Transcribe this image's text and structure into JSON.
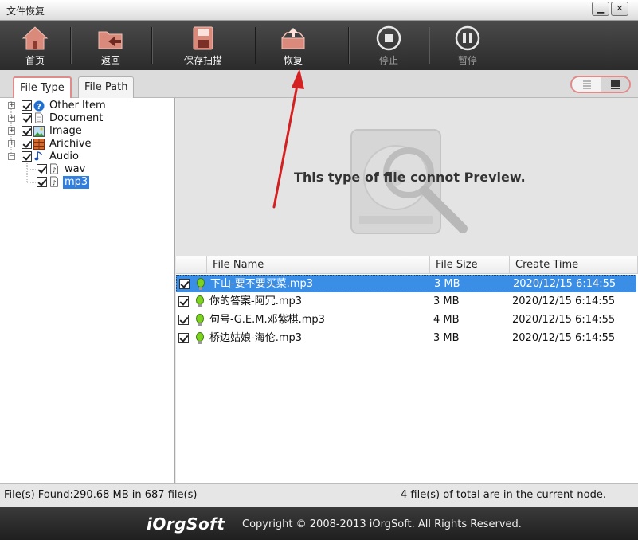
{
  "window": {
    "title": "文件恢复",
    "minimize": "▁",
    "close": "✕"
  },
  "toolbar": {
    "home": "首页",
    "back": "返回",
    "save_scan": "保存扫描",
    "recover": "恢复",
    "stop": "停止",
    "pause": "暂停"
  },
  "tabs": [
    {
      "label": "File Type",
      "active": true
    },
    {
      "label": "File Path",
      "active": false
    }
  ],
  "tree": {
    "items": [
      {
        "label": "Other Item",
        "icon": "help-icon"
      },
      {
        "label": "Document",
        "icon": "document-icon"
      },
      {
        "label": "Image",
        "icon": "image-icon"
      },
      {
        "label": "Arichive",
        "icon": "archive-icon"
      },
      {
        "label": "Audio",
        "icon": "music-note-icon",
        "children": [
          {
            "label": "wav"
          },
          {
            "label": "mp3",
            "selected": true
          }
        ]
      }
    ]
  },
  "preview": {
    "message": "This type of file connot Preview."
  },
  "list": {
    "columns": [
      "File Name",
      "File Size",
      "Create Time"
    ],
    "rows": [
      {
        "name": "下山-要不要买菜.mp3",
        "size": "3 MB",
        "time": "2020/12/15 6:14:55",
        "selected": true
      },
      {
        "name": "你的答案-阿冗.mp3",
        "size": "3 MB",
        "time": "2020/12/15 6:14:55"
      },
      {
        "name": "句号-G.E.M.邓紫棋.mp3",
        "size": "4 MB",
        "time": "2020/12/15 6:14:55"
      },
      {
        "name": "桥边姑娘-海伦.mp3",
        "size": "3 MB",
        "time": "2020/12/15 6:14:55"
      }
    ]
  },
  "status": {
    "left": "File(s) Found:290.68 MB in 687 file(s)",
    "right": "4 file(s) of total are in the current node."
  },
  "footer": {
    "logo": "iOrgSoft",
    "copyright": "Copyright © 2008-2013 iOrgSoft. All Rights Reserved."
  },
  "colors": {
    "selection": "#3a8ee6",
    "tab_accent": "#e08a8a",
    "annotation_arrow": "#d42020"
  }
}
